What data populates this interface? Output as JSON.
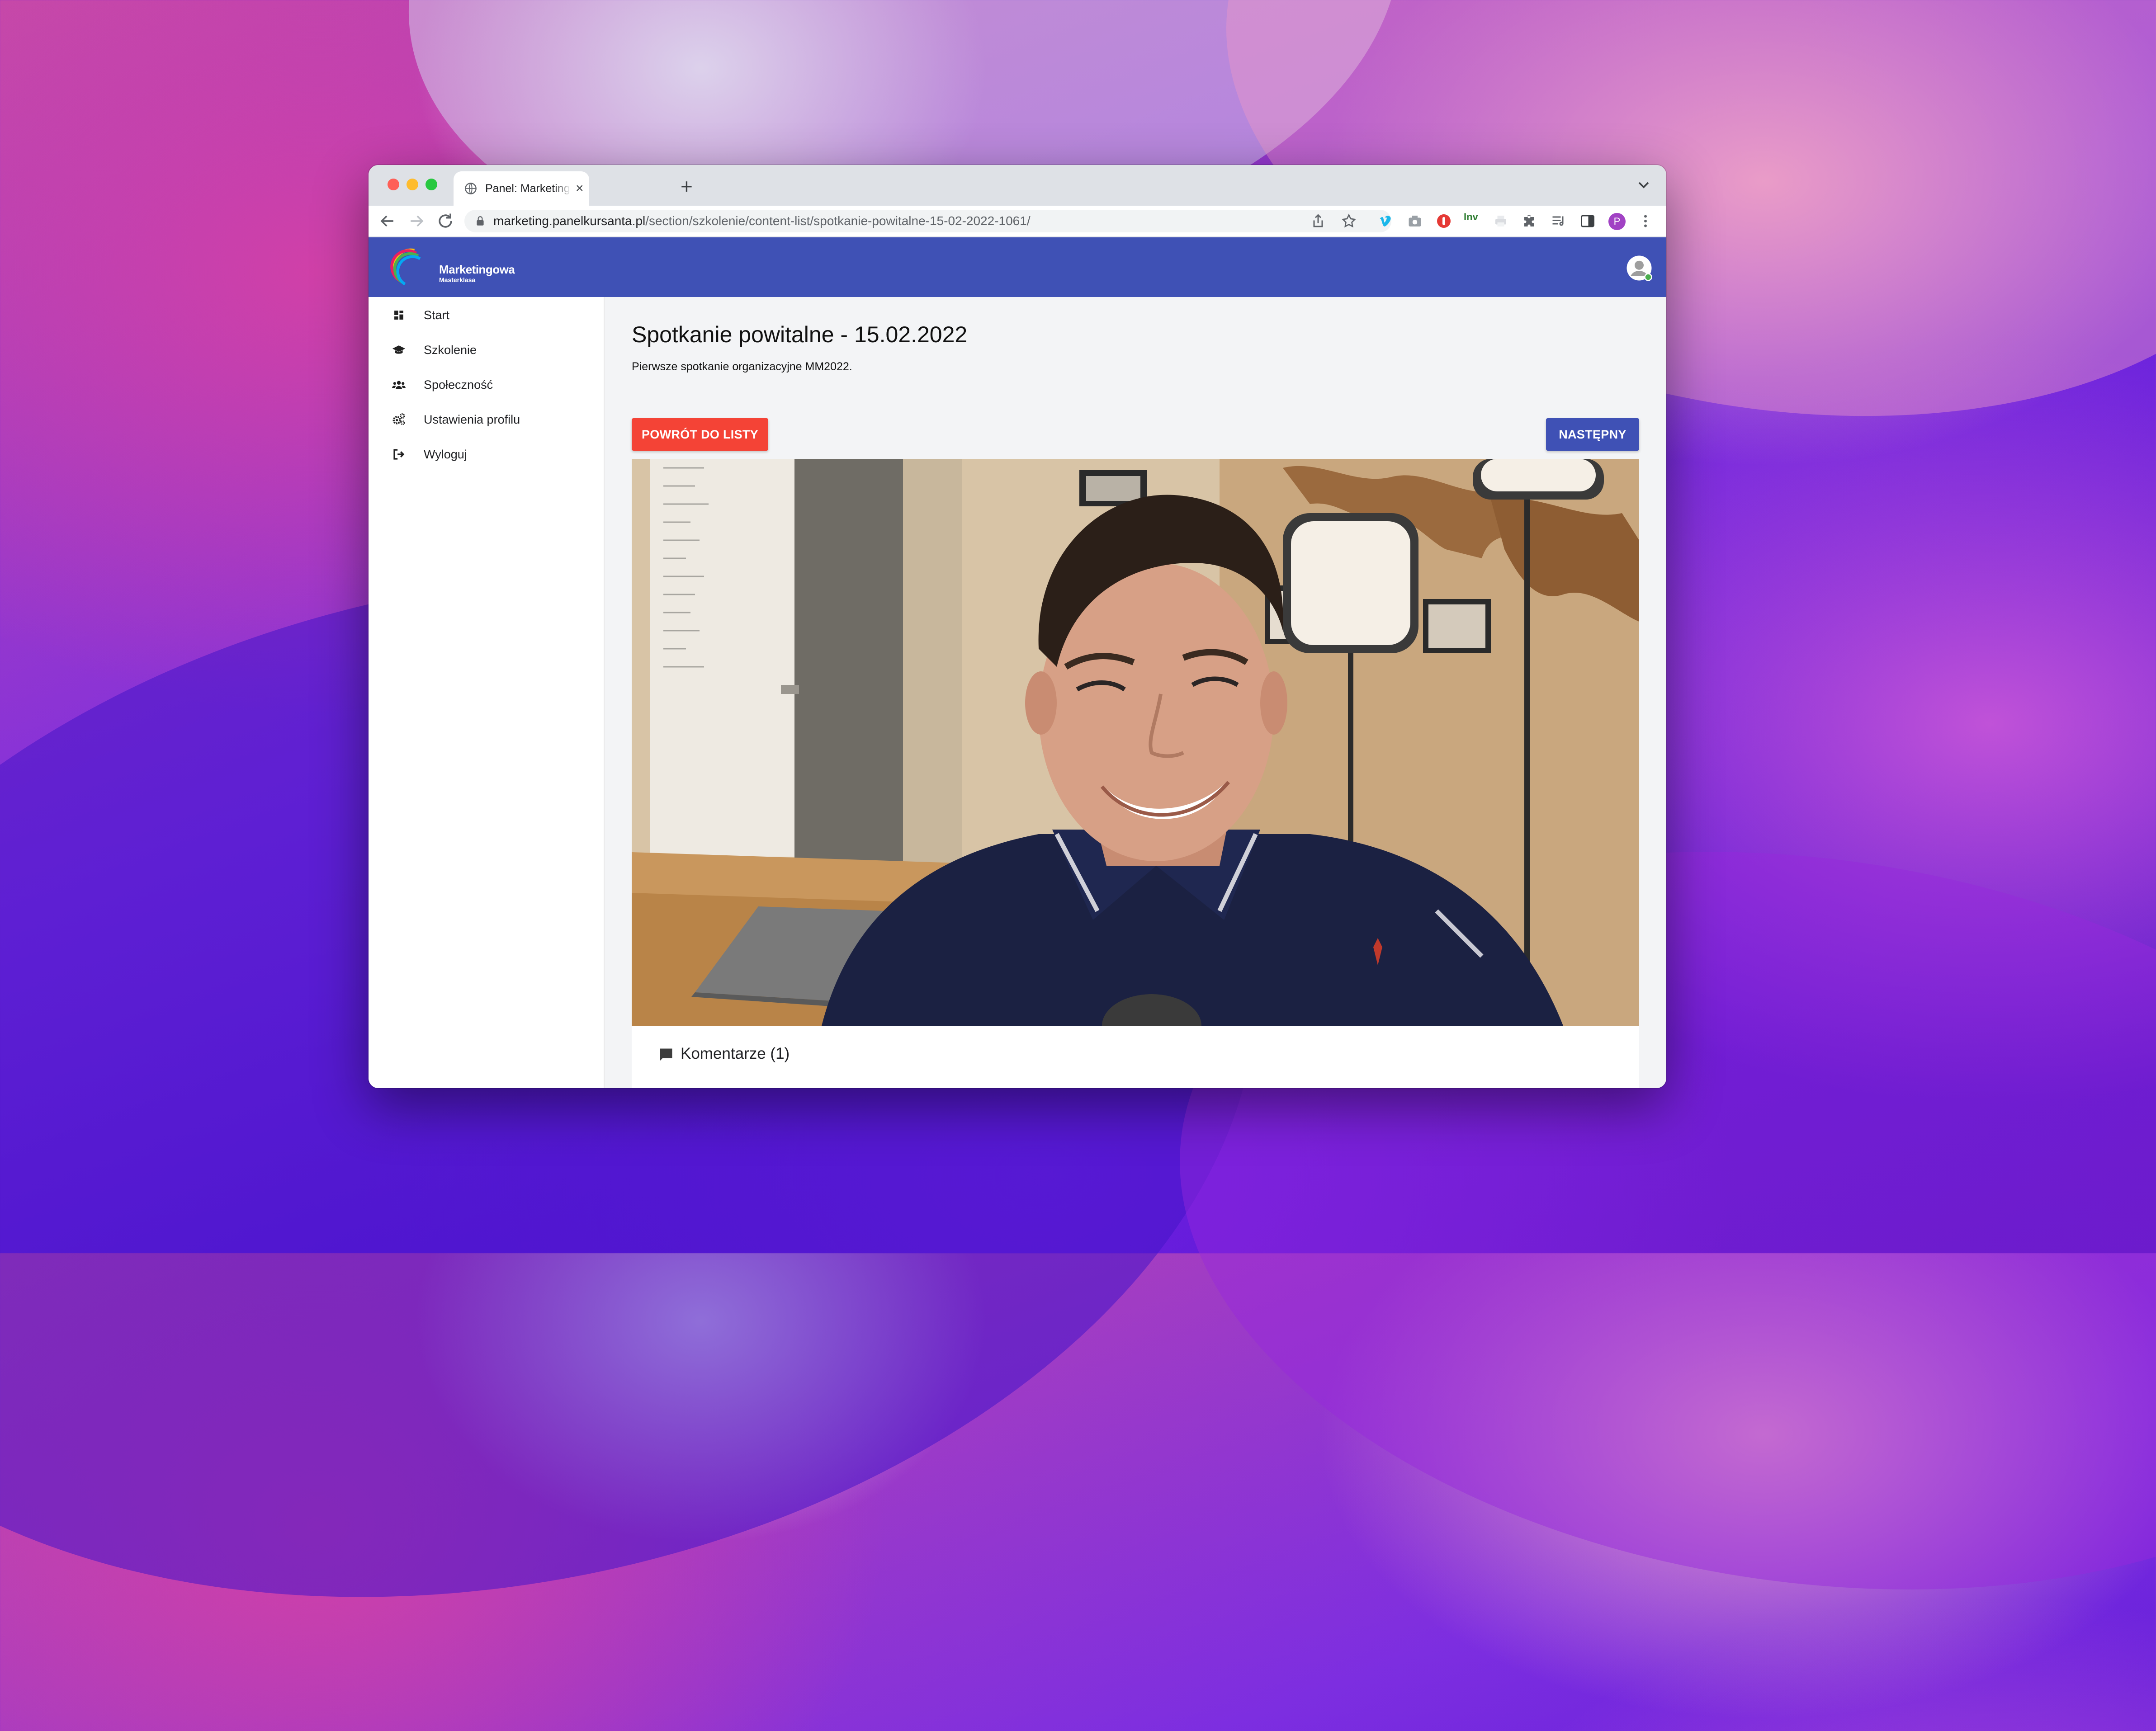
{
  "browser": {
    "tab_title": "Panel: Marketingowa Masterklasa",
    "url_domain": "marketing.panelkursanta.pl",
    "url_path": "/section/szkolenie/content-list/spotkanie-powitalne-15-02-2022-1061/",
    "ext_inv_label": "Inv",
    "profile_initial": "P"
  },
  "site": {
    "logo_title": "Marketingowa",
    "logo_sub": "Masterklasa"
  },
  "sidebar": {
    "items": [
      {
        "label": "Start",
        "icon": "dashboard-icon"
      },
      {
        "label": "Szkolenie",
        "icon": "graduation-cap-icon"
      },
      {
        "label": "Społeczność",
        "icon": "users-icon"
      },
      {
        "label": "Ustawienia profilu",
        "icon": "cogs-icon"
      },
      {
        "label": "Wyloguj",
        "icon": "sign-out-icon"
      }
    ]
  },
  "main": {
    "title": "Spotkanie powitalne - 15.02.2022",
    "subtitle": "Pierwsze spotkanie organizacyjne MM2022.",
    "back_button": "Powrót do listy",
    "next_button": "Następny",
    "comments_label": "Komentarze (1)"
  },
  "colors": {
    "header": "#3f51b5",
    "back_button": "#f44336",
    "next_button": "#3f51b5"
  }
}
